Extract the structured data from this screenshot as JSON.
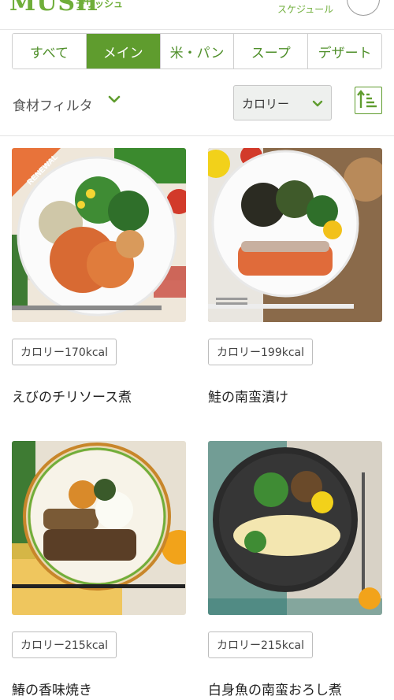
{
  "header": {
    "logo": "MUSH",
    "logo_sub": "デリッシュ",
    "schedule_label": "スケジュール"
  },
  "tabs": [
    {
      "label": "すべて",
      "active": false
    },
    {
      "label": "メイン",
      "active": true
    },
    {
      "label": "米・パン",
      "active": false
    },
    {
      "label": "スープ",
      "active": false
    },
    {
      "label": "デザート",
      "active": false
    }
  ],
  "filter": {
    "label": "食材フィルタ",
    "sort_selected": "カロリー"
  },
  "items": [
    {
      "name": "えびのチリソース煮",
      "calorie_label": "カロリー170kcal",
      "renewal": "RENEWAL"
    },
    {
      "name": "鮭の南蛮漬け",
      "calorie_label": "カロリー199kcal"
    },
    {
      "name": "鰆の香味焼き",
      "calorie_label": "カロリー215kcal"
    },
    {
      "name": "白身魚の南蛮おろし煮",
      "calorie_label": "カロリー215kcal"
    }
  ],
  "colors": {
    "accent": "#5f9c2e",
    "renewal": "#e8733a"
  }
}
